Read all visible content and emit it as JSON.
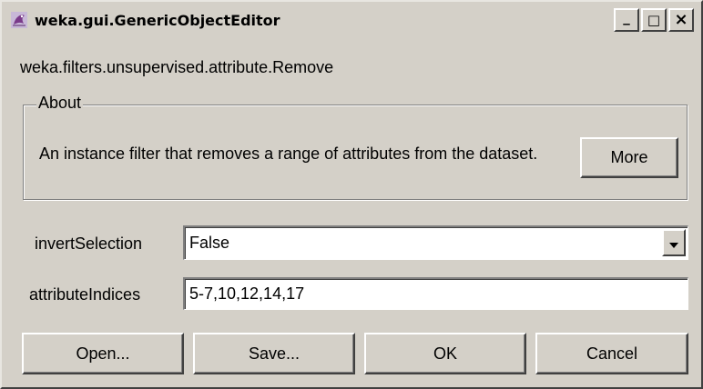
{
  "window": {
    "title": "weka.gui.GenericObjectEditor",
    "controls": {
      "minimize": "_",
      "maximize": "□",
      "close": "×"
    }
  },
  "editor": {
    "class_name": "weka.filters.unsupervised.attribute.Remove",
    "about": {
      "legend": "About",
      "description": "An instance filter that removes a range of attributes from the dataset.",
      "more_label": "More"
    },
    "properties": [
      {
        "label": "invertSelection",
        "type": "dropdown",
        "value": "False"
      },
      {
        "label": "attributeIndices",
        "type": "text",
        "value": "5-7,10,12,14,17"
      }
    ],
    "buttons": {
      "open": "Open...",
      "save": "Save...",
      "ok": "OK",
      "cancel": "Cancel"
    }
  },
  "icons": {
    "app": "weka-bird-icon",
    "combo": "chevron-down-icon"
  }
}
